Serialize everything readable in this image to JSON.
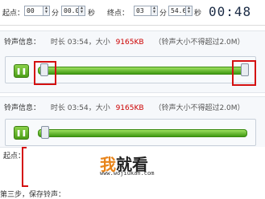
{
  "range_bar": {
    "start_label": "起点：",
    "start_min": "00",
    "start_min_unit": "分",
    "start_sec": "00.0",
    "start_sec_unit": "秒",
    "end_label": "终点：",
    "end_min": "03",
    "end_min_unit": "分",
    "end_sec": "54.6",
    "end_sec_unit": "秒",
    "elapsed": "00:48"
  },
  "panel_1": {
    "info_label": "铃声信息：",
    "duration_text": "时长 03:54，大小",
    "size": "9165KB",
    "note": "（铃声大小不得超过2.0M）",
    "play_icon": "pause-icon",
    "progress": 1.0
  },
  "panel_2": {
    "info_label": "铃声信息：",
    "duration_text": "时长 03:54，大小",
    "size": "9165KB",
    "note": "（铃声大小不得超过2.0M）",
    "play_icon": "pause-icon",
    "progress": 1.0,
    "start_label": "起点："
  },
  "watermark": {
    "logo_char1": "我",
    "logo_chars": "就看",
    "url": "www.wojiukan.com"
  },
  "footer": {
    "step_text": "第三步，保存铃声："
  },
  "colors": {
    "highlight": "#d41010",
    "bar_green": "#4b9e16",
    "size_text": "#cc0000"
  }
}
